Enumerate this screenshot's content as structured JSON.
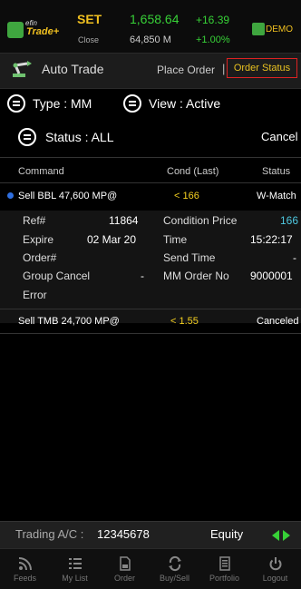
{
  "header": {
    "logo_top": "efin",
    "logo_bottom": "Trade+",
    "market": "SET",
    "close_label": "Close",
    "index_value": "1,658.64",
    "volume": "64,850 M",
    "change": "+16.39",
    "change_pct": "+1.00%",
    "mode_label": "DEMO"
  },
  "titlebar": {
    "title": "Auto Trade",
    "place_order_tab": "Place Order",
    "separator": "|",
    "order_status_tab": "Order Status"
  },
  "filters": {
    "type_label": "Type : MM",
    "view_label": "View : Active",
    "status_label": "Status : ALL",
    "cancel_label": "Cancel"
  },
  "table": {
    "headers": [
      "Command",
      "Cond (Last)",
      "Status"
    ],
    "rows": [
      {
        "command": "Sell BBL 47,600 MP@",
        "cond": "< 166",
        "status": "W-Match",
        "details": {
          "ref_label": "Ref#",
          "ref_value": "11864",
          "condition_price_label": "Condition Price",
          "condition_price_value": "166",
          "expire_label": "Expire",
          "expire_value": "02 Mar 20",
          "time_label": "Time",
          "time_value": "15:22:17",
          "order_label": "Order#",
          "order_value": "",
          "send_time_label": "Send Time",
          "send_time_value": "-",
          "group_cancel_label": "Group Cancel",
          "group_cancel_value": "-",
          "mm_order_label": "MM Order No",
          "mm_order_value": "9000001",
          "error_label": "Error"
        }
      },
      {
        "command": "Sell TMB 24,700 MP@",
        "cond": "< 1.55",
        "status": "Canceled"
      }
    ]
  },
  "account": {
    "label": "Trading A/C :",
    "number": "12345678",
    "type": "Equity"
  },
  "nav": [
    {
      "label": "Feeds",
      "icon": "rss-icon"
    },
    {
      "label": "My List",
      "icon": "list-icon"
    },
    {
      "label": "Order",
      "icon": "document-icon"
    },
    {
      "label": "Buy/Sell",
      "icon": "exchange-icon"
    },
    {
      "label": "Portfolio",
      "icon": "portfolio-icon"
    },
    {
      "label": "Logout",
      "icon": "power-icon"
    }
  ],
  "colors": {
    "positive": "#37d137",
    "accent_yellow": "#f0c020",
    "highlight_cyan": "#4ec8e0",
    "active_tab_border": "#dd2222"
  }
}
